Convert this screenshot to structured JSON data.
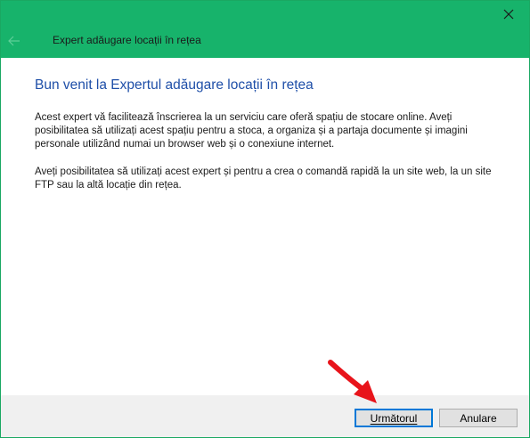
{
  "window": {
    "wizard_title": "Expert adăugare locații în rețea",
    "close_icon": "close-icon",
    "back_icon": "back-arrow-icon",
    "title_bar_color": "#17b36b"
  },
  "main": {
    "heading": "Bun venit la Expertul adăugare locații în rețea",
    "paragraph1": "Acest expert vă facilitează înscrierea la un serviciu care oferă spațiu de stocare online. Aveți posibilitatea să utilizați acest spațiu pentru a stoca, a organiza și a partaja documente și imagini personale utilizând numai un browser web și o conexiune internet.",
    "paragraph2": "Aveți posibilitatea să utilizați acest expert și pentru a crea o comandă rapidă la un site web, la un site FTP sau la altă locație din rețea."
  },
  "footer": {
    "next_label": "Următorul",
    "cancel_label": "Anulare"
  },
  "annotation": {
    "arrow_icon": "red-pointer-arrow-icon",
    "color": "#e8141b"
  }
}
